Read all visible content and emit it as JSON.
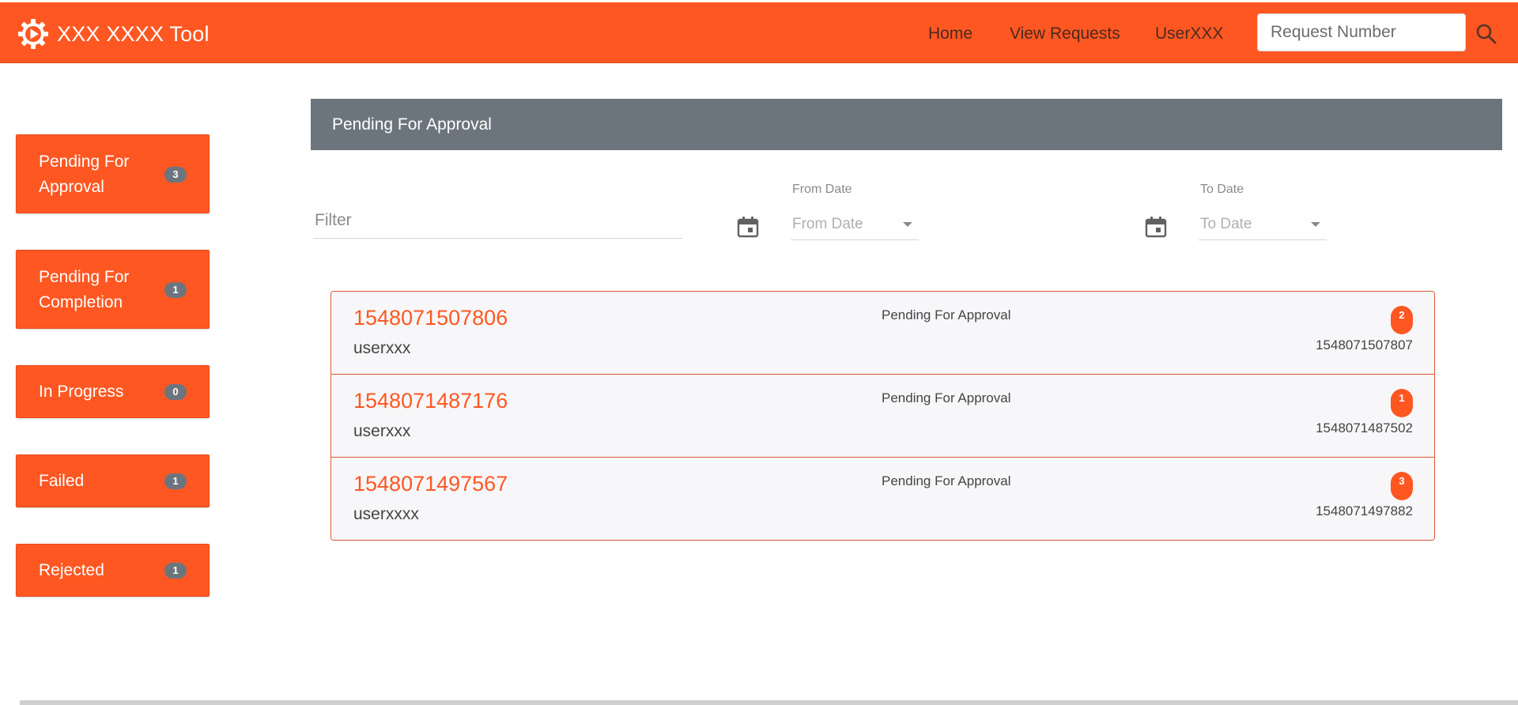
{
  "app": {
    "title": "XXX XXXX Tool",
    "logo_icon": "gear-play-icon"
  },
  "nav": {
    "home": "Home",
    "view_requests": "View Requests",
    "user": "UserXXX"
  },
  "search": {
    "placeholder": "Request Number",
    "icon": "search-icon"
  },
  "sidebar": {
    "items": [
      {
        "label": "Pending For Approval",
        "count": "3"
      },
      {
        "label": "Pending For Completion",
        "count": "1"
      },
      {
        "label": "In Progress",
        "count": "0"
      },
      {
        "label": "Failed",
        "count": "1"
      },
      {
        "label": "Rejected",
        "count": "1"
      }
    ]
  },
  "panel": {
    "title": "Pending For Approval"
  },
  "filters": {
    "filter_placeholder": "Filter",
    "from_date_label": "From Date",
    "from_date_placeholder": "From Date",
    "to_date_label": "To Date",
    "to_date_placeholder": "To Date",
    "calendar_icon": "calendar-icon"
  },
  "requests": [
    {
      "id": "1548071507806",
      "user": "userxxx",
      "status": "Pending For Approval",
      "count": "2",
      "number": "1548071507807"
    },
    {
      "id": "1548071487176",
      "user": "userxxx",
      "status": "Pending For Approval",
      "count": "1",
      "number": "1548071487502"
    },
    {
      "id": "1548071497567",
      "user": "userxxxx",
      "status": "Pending For Approval",
      "count": "3",
      "number": "1548071497882"
    }
  ],
  "colors": {
    "brand": "#ff5722",
    "header_gray": "#6c757d",
    "badge_gray": "#6c757d"
  }
}
